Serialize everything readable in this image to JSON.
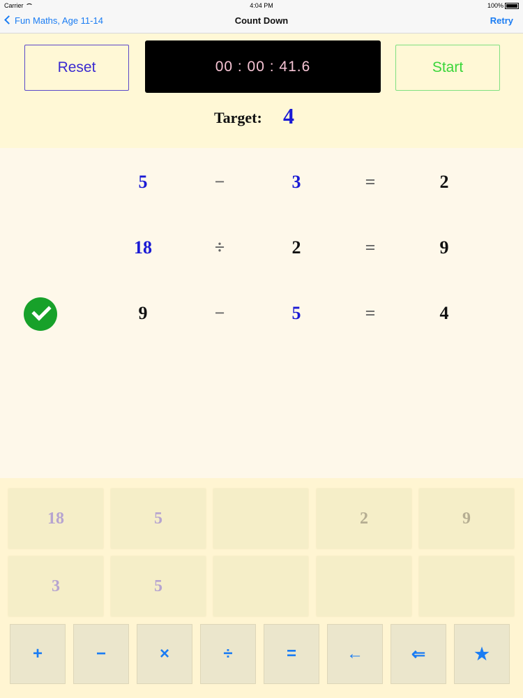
{
  "status_bar": {
    "carrier": "Carrier",
    "time": "4:04 PM",
    "battery": "100%"
  },
  "nav": {
    "back_label": "Fun Maths, Age 11-14",
    "title": "Count Down",
    "retry_label": "Retry"
  },
  "controls": {
    "reset_label": "Reset",
    "timer": "00 : 00 : 41.6",
    "start_label": "Start"
  },
  "target": {
    "label": "Target:",
    "value": "4"
  },
  "equations": [
    {
      "a": "5",
      "op": "−",
      "b": "3",
      "eq": "=",
      "result": "2",
      "solved": false
    },
    {
      "a": "18",
      "op": "÷",
      "b": "2",
      "eq": "=",
      "result": "9",
      "solved": false
    },
    {
      "a": "9",
      "op": "−",
      "b": "5",
      "eq": "=",
      "result": "4",
      "solved": true
    }
  ],
  "number_tiles": {
    "row1": [
      "18",
      "5",
      "",
      "2",
      "9"
    ],
    "row2": [
      "3",
      "5",
      "",
      "",
      ""
    ]
  },
  "operator_keys": [
    "+",
    "−",
    "×",
    "÷",
    "=",
    "←",
    "⇐",
    "★"
  ],
  "colors": {
    "accent": "#1a7cf3",
    "number_blue": "#1a1ad4",
    "check_green": "#17a12a",
    "start_green": "#3ad63a",
    "reset_purple": "#3a2ad0"
  }
}
